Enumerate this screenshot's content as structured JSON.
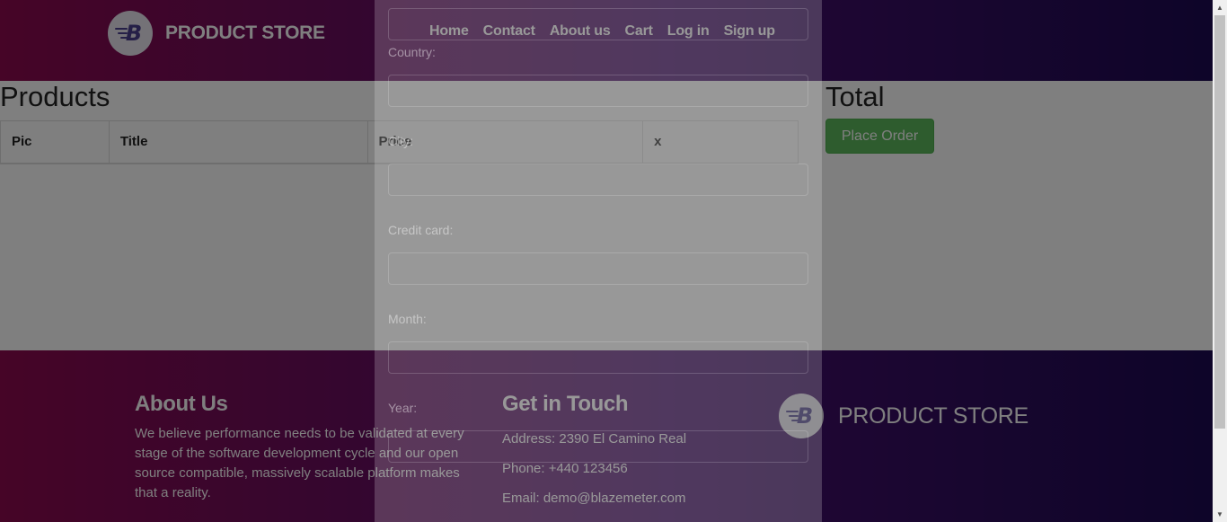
{
  "navbar": {
    "brand": "PRODUCT STORE",
    "links": [
      "Home",
      "Contact",
      "About us",
      "Cart",
      "Log in",
      "Sign up"
    ]
  },
  "cart": {
    "products_title": "Products",
    "columns": [
      "Pic",
      "Title",
      "Price",
      "x"
    ],
    "total_title": "Total",
    "place_order_label": "Place Order"
  },
  "order_modal": {
    "fields": [
      "Country:",
      "City:",
      "Credit card:",
      "Month:",
      "Year:"
    ]
  },
  "footer": {
    "about_heading": "About Us",
    "about_text": "We believe performance needs to be validated at every stage of the software development cycle and our open source compatible, massively scalable platform makes that a reality.",
    "touch_heading": "Get in Touch",
    "address": "Address: 2390 El Camino Real",
    "phone": "Phone: +440 123456",
    "email": "Email: demo@blazemeter.com",
    "brand": "PRODUCT STORE"
  },
  "colors": {
    "gradient_start": "#8c0a4e",
    "gradient_mid": "#4a0f6e",
    "gradient_end": "#1c0a52",
    "place_order": "#5cb85c"
  },
  "icons": {
    "brand_logo": "blazemeter-b-logo-icon",
    "scroll_up": "triangle-up-icon",
    "scroll_down": "triangle-down-icon"
  }
}
